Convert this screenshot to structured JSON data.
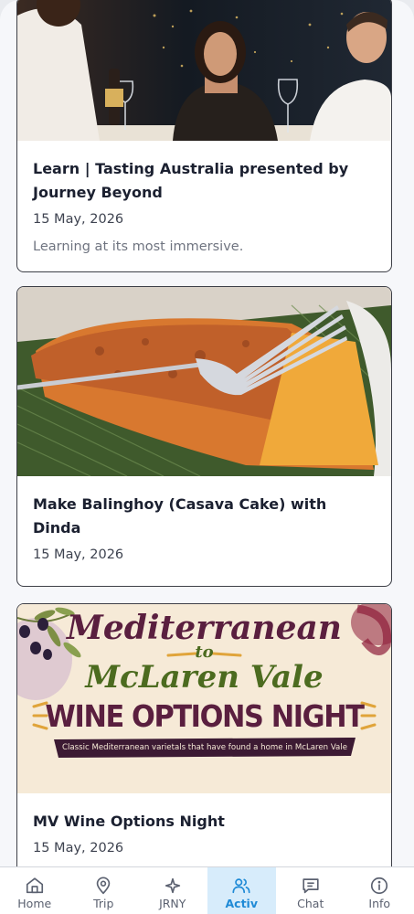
{
  "activities": [
    {
      "title": "Learn | Tasting Australia presented by Journey Beyond",
      "date": "15 May, 2026",
      "description": "Learning at its most immersive."
    },
    {
      "title": "Make Balinghoy (Casava Cake) with Dinda",
      "date": "15 May, 2026"
    },
    {
      "title": "MV Wine Options Night",
      "date": "15 May, 2026",
      "poster": {
        "line1": "Mediterranean",
        "line2": "to",
        "line3": "McLaren Vale",
        "line4": "WINE OPTIONS NIGHT",
        "tagline": "Classic Mediterranean varietals that have found a home in McLaren Vale"
      }
    }
  ],
  "tabs": [
    {
      "label": "Home",
      "icon": "home-icon"
    },
    {
      "label": "Trip",
      "icon": "map-pin-icon"
    },
    {
      "label": "JRNY",
      "icon": "sparkle-icon"
    },
    {
      "label": "Activ",
      "icon": "users-icon",
      "active": true
    },
    {
      "label": "Chat",
      "icon": "chat-icon"
    },
    {
      "label": "Info",
      "icon": "info-icon"
    }
  ],
  "colors": {
    "active_tab_bg": "#d7ecfb",
    "active_tab_fg": "#1f8ad6",
    "poster_purple": "#5a1f3f",
    "poster_green": "#4c6b1f"
  }
}
